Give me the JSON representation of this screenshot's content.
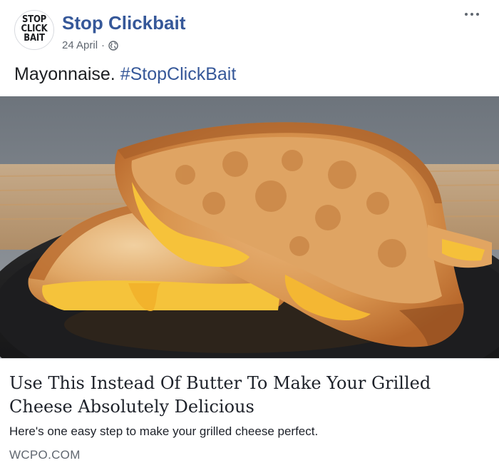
{
  "post": {
    "page_name": "Stop Clickbait",
    "avatar_lines": [
      "STOP",
      "CLICK",
      "BAIT"
    ],
    "date": "24 April",
    "separator": "·",
    "privacy_icon": "globe-icon",
    "more_icon": "more-options-icon",
    "text": "Mayonnaise.",
    "hashtag": "#StopClickBait"
  },
  "link": {
    "image_subject": "grilled cheese sandwich",
    "title": "Use This Instead Of Butter To Make Your Grilled Cheese Absolutely Delicious",
    "description": "Here's one easy step to make your grilled cheese perfect.",
    "domain": "WCPO.COM"
  },
  "colors": {
    "link_blue": "#365899",
    "text": "#1c1e21",
    "meta_gray": "#606770"
  }
}
